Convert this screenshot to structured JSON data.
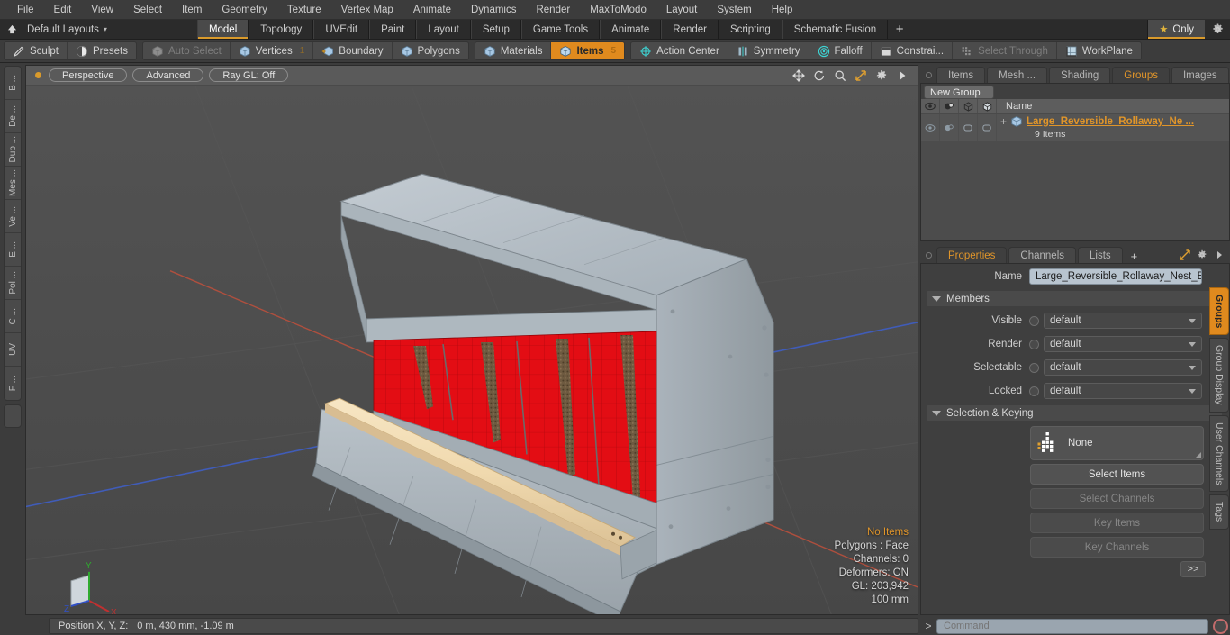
{
  "menu": {
    "items": [
      "File",
      "Edit",
      "View",
      "Select",
      "Item",
      "Geometry",
      "Texture",
      "Vertex Map",
      "Animate",
      "Dynamics",
      "Render",
      "MaxToModo",
      "Layout",
      "System",
      "Help"
    ]
  },
  "layout_bar": {
    "home_icon": "home-icon",
    "layouts_label": "Default Layouts",
    "caret": "▾",
    "tabs": [
      {
        "label": "Model",
        "active": true
      },
      {
        "label": "Topology",
        "active": false
      },
      {
        "label": "UVEdit",
        "active": false
      },
      {
        "label": "Paint",
        "active": false
      },
      {
        "label": "Layout",
        "active": false
      },
      {
        "label": "Setup",
        "active": false
      },
      {
        "label": "Game Tools",
        "active": false
      },
      {
        "label": "Animate",
        "active": false
      },
      {
        "label": "Render",
        "active": false
      },
      {
        "label": "Scripting",
        "active": false
      },
      {
        "label": "Schematic Fusion",
        "active": false
      }
    ],
    "add_label": "+",
    "only_label": "Only",
    "star_glyph": "★",
    "gear_icon": "gear-icon"
  },
  "toolbar": {
    "group1": [
      {
        "label": "Sculpt",
        "icon": "pencil-icon",
        "active": false,
        "dim": false
      },
      {
        "label": "Presets",
        "icon": "sphere-icon",
        "active": false,
        "dim": false
      }
    ],
    "group2": [
      {
        "label": "Auto Select",
        "icon": "cube-gray-icon",
        "active": false,
        "dim": true,
        "count": ""
      },
      {
        "label": "Vertices",
        "icon": "cube-blue-icon",
        "active": false,
        "dim": false,
        "count": "1"
      },
      {
        "label": "Boundary",
        "icon": "cube-arrow-icon",
        "active": false,
        "dim": false,
        "count": ""
      },
      {
        "label": "Polygons",
        "icon": "cube-blue-icon",
        "active": false,
        "dim": false,
        "count": ""
      }
    ],
    "group3": [
      {
        "label": "Materials",
        "icon": "cube-blue-icon",
        "active": false,
        "dim": false,
        "count": ""
      },
      {
        "label": "Items",
        "icon": "cube-blue-icon",
        "active": true,
        "dim": false,
        "count": "5"
      }
    ],
    "group4": [
      {
        "label": "Action Center",
        "icon": "crosshair-icon",
        "active": false,
        "dim": false
      },
      {
        "label": "Symmetry",
        "icon": "symmetry-icon",
        "active": false,
        "dim": false
      },
      {
        "label": "Falloff",
        "icon": "falloff-icon",
        "active": false,
        "dim": false
      },
      {
        "label": "Constrai...",
        "icon": "constrain-icon",
        "active": false,
        "dim": false
      },
      {
        "label": "Select Through",
        "icon": "select-through-icon",
        "active": false,
        "dim": true
      },
      {
        "label": "WorkPlane",
        "icon": "workplane-icon",
        "active": false,
        "dim": false
      }
    ]
  },
  "left_rail": {
    "tabs": [
      "B ...",
      "De ...",
      "Dup ...",
      "Mes ...",
      "Ve ...",
      "E ...",
      "Pol ...",
      "C ...",
      "UV",
      "F ..."
    ]
  },
  "viewport": {
    "indicator_dot": "active-dot",
    "pills": [
      "Perspective",
      "Advanced",
      "Ray GL: Off"
    ],
    "nav_icons": [
      "pan-icon",
      "rotate-icon",
      "zoom-icon",
      "fit-icon",
      "viewport-settings-icon",
      "more-arrow-icon"
    ],
    "info": {
      "selection": "No Items",
      "polygons": "Polygons : Face",
      "channels": "Channels: 0",
      "deformers": "Deformers: ON",
      "gl": "GL: 203,942",
      "grid": "100 mm"
    },
    "axis_labels": {
      "x": "X",
      "y": "Y",
      "z": "Z"
    },
    "colors": {
      "background": "#4c4c4c",
      "model_gray": "#b3bcc4",
      "model_red": "#e8141a",
      "model_wood": "#f2dcb4",
      "x_axis": "#b4503c",
      "z_axis": "#3a55b4",
      "grid": "#565656"
    }
  },
  "status_bar": {
    "label": "Position X, Y, Z:",
    "value": "0 m, 430 mm, -1.09 m"
  },
  "right_panel": {
    "top_tabs": [
      {
        "label": "Items",
        "active": false
      },
      {
        "label": "Mesh ...",
        "active": false
      },
      {
        "label": "Shading",
        "active": false
      },
      {
        "label": "Groups",
        "active": true
      },
      {
        "label": "Images",
        "active": false
      }
    ],
    "top_tabs_plus": "+",
    "top_tab_icons": [
      "expand-icon",
      "more-arrow-icon"
    ],
    "new_group_label": "New Group",
    "list": {
      "column_icons": [
        "eye-icon",
        "render-icon",
        "wireframe-icon",
        "shaded-icon"
      ],
      "name_header": "Name",
      "rows": [
        {
          "expand": "+",
          "icon": "group-icon",
          "title": "Large_Reversible_Rollaway_Ne ...",
          "subtitle": "9 Items"
        }
      ]
    },
    "properties": {
      "tabs": [
        {
          "label": "Properties",
          "active": true
        },
        {
          "label": "Channels",
          "active": false
        },
        {
          "label": "Lists",
          "active": false
        }
      ],
      "tabs_plus": "+",
      "tab_icons": [
        "expand-icon",
        "gear-icon",
        "more-arrow-icon"
      ],
      "name_label": "Name",
      "name_value": "Large_Reversible_Rollaway_Nest_Box",
      "members_section": "Members",
      "members_fields": [
        {
          "label": "Visible",
          "value": "default"
        },
        {
          "label": "Render",
          "value": "default"
        },
        {
          "label": "Selectable",
          "value": "default"
        },
        {
          "label": "Locked",
          "value": "default"
        }
      ],
      "selection_section": "Selection & Keying",
      "selection_buttons": [
        {
          "label": "None",
          "type": "picker",
          "disabled": false
        },
        {
          "label": "Select Items",
          "type": "button",
          "disabled": false
        },
        {
          "label": "Select Channels",
          "type": "button",
          "disabled": true
        },
        {
          "label": "Key Items",
          "type": "button",
          "disabled": true
        },
        {
          "label": "Key Channels",
          "type": "button",
          "disabled": true
        }
      ],
      "expand_more_label": ">>"
    },
    "vertical_tabs": [
      {
        "label": "Groups",
        "active": true
      },
      {
        "label": "Group Display",
        "active": false
      },
      {
        "label": "User Channels",
        "active": false
      },
      {
        "label": "Tags",
        "active": false
      }
    ]
  },
  "command_bar": {
    "prompt": ">",
    "placeholder": "Command",
    "record_icon": "record-icon"
  }
}
